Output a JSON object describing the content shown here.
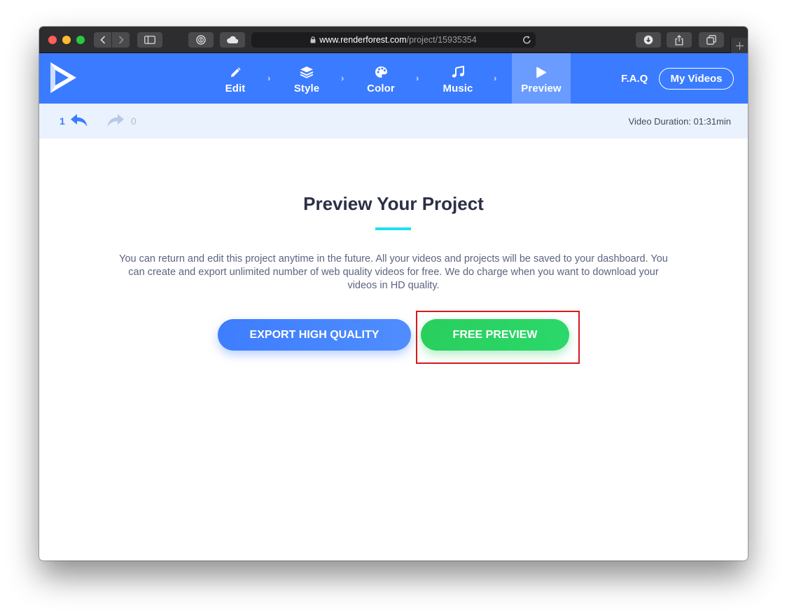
{
  "browser": {
    "url_domain": "www.renderforest.com",
    "url_path": "/project/15935354"
  },
  "nav": {
    "steps": [
      {
        "label": "Edit",
        "icon": "pencil-icon"
      },
      {
        "label": "Style",
        "icon": "layers-icon"
      },
      {
        "label": "Color",
        "icon": "palette-icon"
      },
      {
        "label": "Music",
        "icon": "music-note-icon"
      },
      {
        "label": "Preview",
        "icon": "play-icon"
      }
    ],
    "active_step": "Preview",
    "faq_label": "F.A.Q",
    "my_videos_label": "My Videos"
  },
  "history": {
    "undo_count": "1",
    "redo_count": "0",
    "duration_text": "Video Duration: 01:31min"
  },
  "main": {
    "title": "Preview Your Project",
    "description": "You can return and edit this project anytime in the future. All your videos and projects will be saved to your dashboard. You can create and export unlimited number of web quality videos for free. We do charge when you want to download your videos in HD quality.",
    "export_label": "EXPORT HIGH QUALITY",
    "preview_label": "FREE PREVIEW"
  },
  "colors": {
    "header_blue": "#3b7bff",
    "active_step": "#6a9cff",
    "accent_cyan": "#1fe0ee",
    "export_blue": "#3e7dfd",
    "preview_green": "#29cf5d",
    "highlight_red": "#d7191c"
  }
}
